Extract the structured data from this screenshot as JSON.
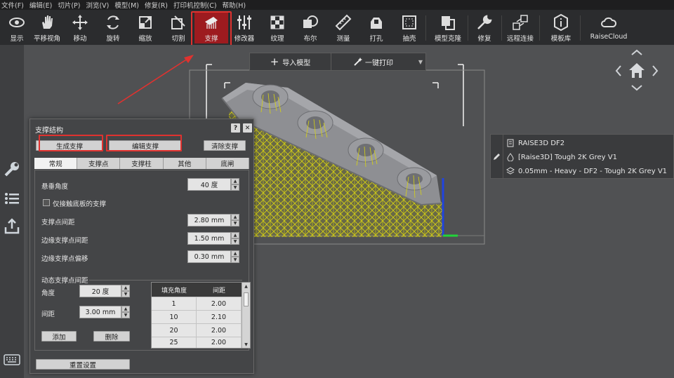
{
  "menu": [
    "文件(F)",
    "编辑(E)",
    "切片(P)",
    "浏览(V)",
    "模型(M)",
    "修复(R)",
    "打印机控制(C)",
    "帮助(H)"
  ],
  "toolbar": [
    {
      "label": "显示",
      "icon": "eye-icon"
    },
    {
      "label": "平移视角",
      "icon": "hand-icon"
    },
    {
      "label": "移动",
      "icon": "move-icon"
    },
    {
      "label": "旋转",
      "icon": "rotate-icon"
    },
    {
      "label": "缩放",
      "icon": "scale-icon"
    },
    {
      "label": "切割",
      "icon": "cut-icon"
    },
    {
      "label": "支撑",
      "icon": "support-icon",
      "active": true
    },
    {
      "label": "修改器",
      "icon": "modifier-icon"
    },
    {
      "label": "纹理",
      "icon": "texture-icon"
    },
    {
      "label": "布尔",
      "icon": "boolean-icon"
    },
    {
      "label": "测量",
      "icon": "ruler-icon"
    },
    {
      "label": "打孔",
      "icon": "punch-icon"
    },
    {
      "label": "抽壳",
      "icon": "shell-icon"
    },
    {
      "label": "模型克隆",
      "icon": "clone-icon"
    },
    {
      "label": "修复",
      "icon": "repair-icon"
    },
    {
      "label": "远程连接",
      "icon": "remote-icon"
    },
    {
      "label": "模板库",
      "icon": "template-icon"
    },
    {
      "label": "RaiseCloud",
      "icon": "cloud-icon"
    }
  ],
  "viewport": {
    "import_label": "导入模型",
    "print_label": "一键打印"
  },
  "info": {
    "printer": "RAISE3D DF2",
    "material": "[Raise3D] Tough 2K Grey V1",
    "profile": "0.05mm - Heavy - DF2 - Tough 2K Grey V1"
  },
  "dialog": {
    "title": "支撑结构",
    "help": "?",
    "close": "✕",
    "generate": "生成支撑",
    "edit": "编辑支撑",
    "clear": "清除支撑",
    "tabs": [
      "常规",
      "支撑点",
      "支撑柱",
      "其他",
      "底闸"
    ],
    "overhang_angle_label": "悬垂角度",
    "overhang_angle": "40 度",
    "touch_plate_label": "仅接触底板的支撑",
    "point_spacing_label": "支撑点间距",
    "point_spacing": "2.80 mm",
    "edge_spacing_label": "边缘支撑点间距",
    "edge_spacing": "1.50 mm",
    "edge_offset_label": "边缘支撑点偏移",
    "edge_offset": "0.30 mm",
    "dynamic_group_label": "动态支撑点间距",
    "angle_label": "角度",
    "angle_value": "20 度",
    "spacing_label": "间距",
    "spacing_value": "3.00 mm",
    "add": "添加",
    "delete": "删除",
    "table_headers": [
      "填充角度",
      "间距"
    ],
    "table_rows": [
      [
        "1",
        "2.00"
      ],
      [
        "10",
        "2.10"
      ],
      [
        "20",
        "2.00"
      ],
      [
        "25",
        "2.00"
      ]
    ],
    "reset": "重置设置"
  },
  "colors": {
    "accent_red": "#9d1b1f",
    "highlight": "#e0322f",
    "support_yellow": "#d7d312",
    "model_grey": "#8e8f93"
  }
}
